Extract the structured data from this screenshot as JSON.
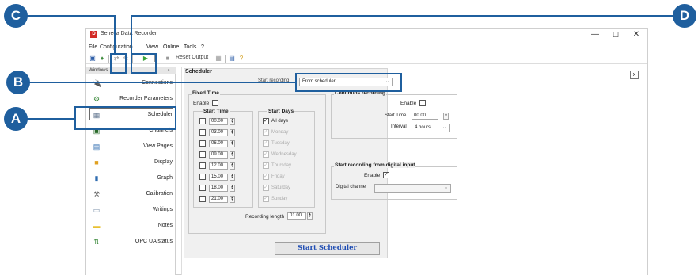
{
  "window": {
    "app_icon_letter": "D",
    "title": "Seneca Data Recorder",
    "minimize_glyph": "—",
    "maximize_glyph": "☐",
    "close_glyph": "✕"
  },
  "menubar": {
    "items": [
      "File",
      "Configuration",
      "View",
      "Online",
      "Tools",
      "?"
    ]
  },
  "toolbar": {
    "reset_output_label": "Reset Output",
    "icons": [
      "save-icon",
      "open-icon",
      "connect-icon",
      "disconnect-icon",
      "play-icon",
      "pause-icon",
      "stop-icon",
      "reset-icon",
      "info-icon",
      "help-icon"
    ]
  },
  "sidebar": {
    "title": "Windows",
    "pin_glyph": "ₒ",
    "items": [
      {
        "label": "Connections",
        "icon": "connections-icon",
        "glyph": "🔌",
        "color": "#3d8b3d"
      },
      {
        "label": "Recorder Parameters",
        "icon": "recorder-parameters-icon",
        "glyph": "⚙",
        "color": "#3d8b3d"
      },
      {
        "label": "Scheduler",
        "icon": "scheduler-icon",
        "glyph": "▦",
        "color": "#5a6f8a"
      },
      {
        "label": "Channels",
        "icon": "channels-icon",
        "glyph": "▣",
        "color": "#2a6b2a"
      },
      {
        "label": "View Pages",
        "icon": "view-pages-icon",
        "glyph": "▤",
        "color": "#2f6cb0"
      },
      {
        "label": "Display",
        "icon": "display-icon",
        "glyph": "■",
        "color": "#e0a020"
      },
      {
        "label": "Graph",
        "icon": "graph-icon",
        "glyph": "▮",
        "color": "#2f6cb0"
      },
      {
        "label": "Calibration",
        "icon": "calibration-icon",
        "glyph": "⚒",
        "color": "#666666"
      },
      {
        "label": "Writings",
        "icon": "writings-icon",
        "glyph": "▭",
        "color": "#7a8fa8"
      },
      {
        "label": "Notes",
        "icon": "notes-icon",
        "glyph": "▬",
        "color": "#e8c030"
      },
      {
        "label": "OPC UA status",
        "icon": "opc-ua-status-icon",
        "glyph": "⇅",
        "color": "#3d8b3d"
      }
    ],
    "selected_index": 2
  },
  "scheduler": {
    "title": "Scheduler",
    "close_glyph": "x",
    "start_recording_label": "Start recording",
    "start_recording_value": "From scheduler",
    "fixed_time": {
      "title": "Fixed Time",
      "enable_label": "Enable",
      "enable_checked": false,
      "start_time_title": "Start Time",
      "times": [
        "00.00",
        "03.00",
        "06.00",
        "09.00",
        "12.00",
        "15.00",
        "18.00",
        "21.00"
      ],
      "start_days_title": "Start Days",
      "days": [
        {
          "label": "All days",
          "checked": true,
          "enabled": true
        },
        {
          "label": "Monday",
          "checked": true,
          "enabled": false
        },
        {
          "label": "Tuesday",
          "checked": true,
          "enabled": false
        },
        {
          "label": "Wednesday",
          "checked": true,
          "enabled": false
        },
        {
          "label": "Thursday",
          "checked": true,
          "enabled": false
        },
        {
          "label": "Friday",
          "checked": true,
          "enabled": false
        },
        {
          "label": "Saturday",
          "checked": true,
          "enabled": false
        },
        {
          "label": "Sunday",
          "checked": true,
          "enabled": false
        }
      ],
      "recording_length_label": "Recording length",
      "recording_length_value": "01.00"
    },
    "continuous": {
      "title": "Continuos recording",
      "enable_label": "Enable",
      "enable_checked": false,
      "start_time_label": "Start Time",
      "start_time_value": "00.00",
      "interval_label": "Interval",
      "interval_value": "4 hours"
    },
    "digital": {
      "title": "Start recording from digital input",
      "enable_label": "Enable",
      "enable_checked": true,
      "channel_label": "Digital channel",
      "channel_value": ""
    },
    "start_button_label": "Start Scheduler"
  },
  "callouts": {
    "a": "A",
    "b": "B",
    "c": "C",
    "d": "D",
    "color": "#1f5f9e"
  }
}
